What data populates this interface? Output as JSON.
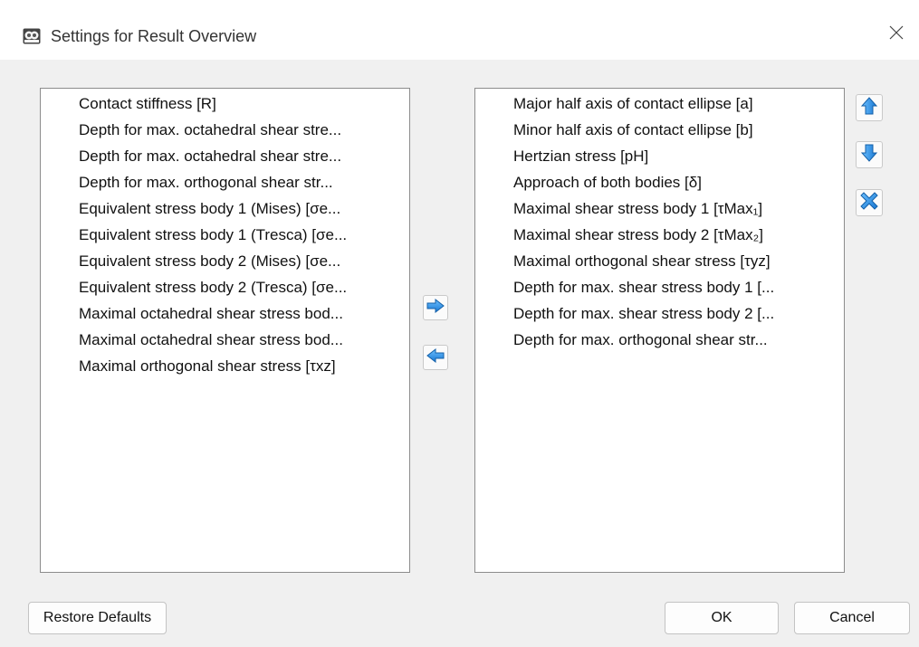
{
  "window": {
    "title": "Settings for Result Overview",
    "close_symbol": "×"
  },
  "available_list": {
    "items": [
      "Contact stiffness [R]",
      "Depth for max. octahedral shear stre...",
      "Depth for max. octahedral shear stre...",
      "Depth for max. orthogonal shear str...",
      "Equivalent stress body 1 (Mises) [σe...",
      "Equivalent stress body 1 (Tresca) [σe...",
      "Equivalent stress body 2 (Mises) [σe...",
      "Equivalent stress body 2 (Tresca) [σe...",
      "Maximal octahedral shear stress bod...",
      "Maximal octahedral shear stress bod...",
      "Maximal orthogonal shear stress [τxz]"
    ]
  },
  "selected_list": {
    "items": [
      "Major half axis of contact ellipse [a]",
      "Minor half axis of contact ellipse [b]",
      "Hertzian stress [pH]",
      "Approach of both bodies [δ]",
      "Maximal shear stress body 1 [τMax₁]",
      "Maximal shear stress body 2 [τMax₂]",
      "Maximal orthogonal shear stress [τyz]",
      "Depth for max. shear stress body 1 [...",
      "Depth for max. shear stress body 2 [...",
      "Depth for max. orthogonal shear str..."
    ]
  },
  "transfer_buttons": {
    "add_icon": "arrow-right-icon",
    "remove_icon": "arrow-left-icon"
  },
  "order_buttons": {
    "up_icon": "arrow-up-icon",
    "down_icon": "arrow-down-icon",
    "delete_icon": "delete-x-icon"
  },
  "footer": {
    "restore_label": "Restore Defaults",
    "ok_label": "OK",
    "cancel_label": "Cancel"
  },
  "colors": {
    "accent": "#2a8fe0",
    "dialog_background": "#f0f0f0"
  }
}
